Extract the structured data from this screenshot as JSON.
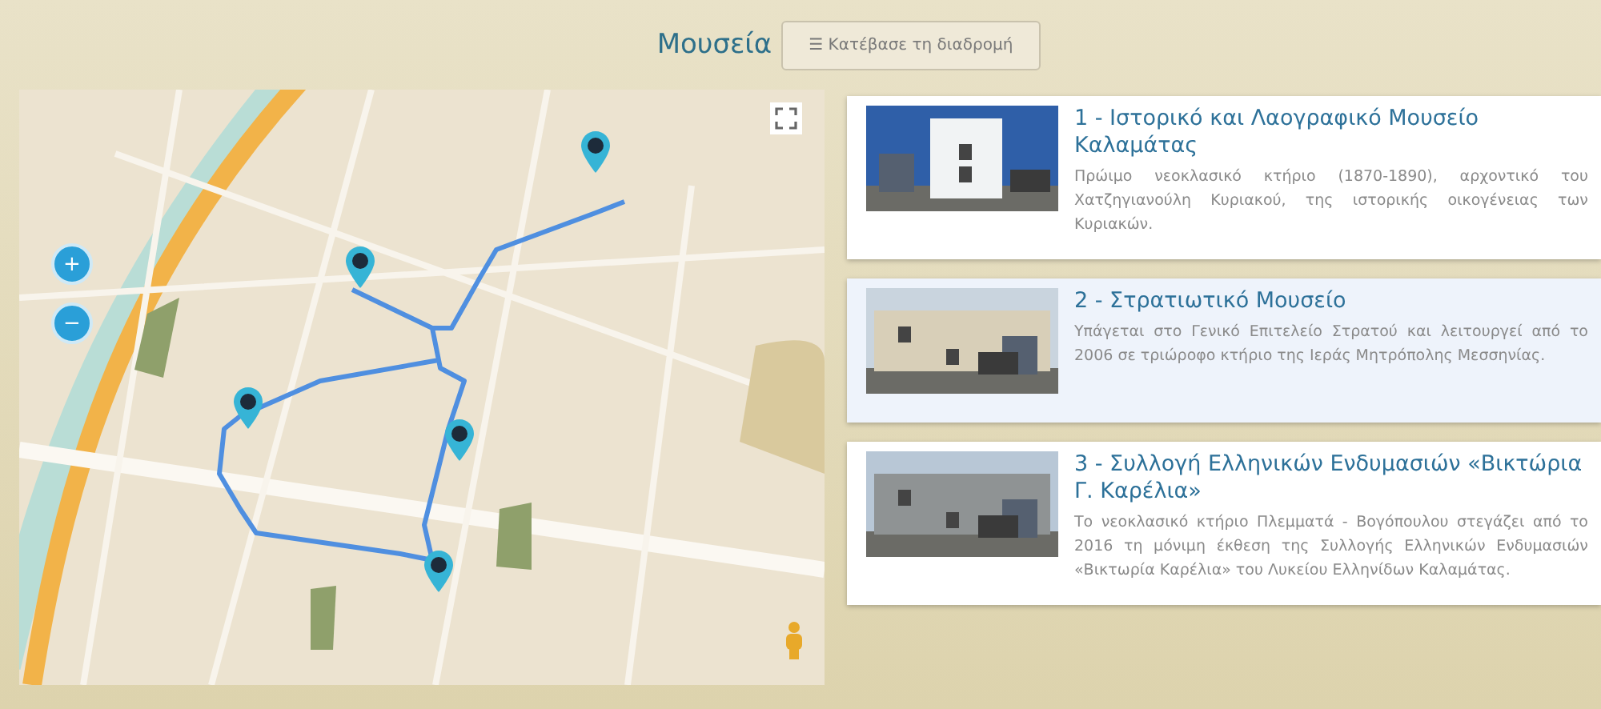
{
  "header": {
    "title": "Μουσεία",
    "download_button": {
      "icon": "☰",
      "label": "Κατέβασε τη διαδρομή"
    }
  },
  "map": {
    "kind": "picture",
    "zoom_in": "+",
    "zoom_out": "−"
  },
  "museums": [
    {
      "title": "1 - Ιστορικό και Λαογραφικό Μουσείο Καλαμάτας",
      "description": "Πρώιμο νεοκλασικό κτήριο (1870-1890), αρχοντικό του Χατζηγιανούλη Κυριακού, της ιστορικής οικογένειας των Κυριακών.",
      "selected": false
    },
    {
      "title": "2 - Στρατιωτικό Μουσείο",
      "description": "Υπάγεται στο Γενικό Επιτελείο Στρατού και λειτουργεί από το 2006 σε τριώροφο κτήριο της Ιεράς Μητρόπολης Μεσσηνίας.",
      "selected": true
    },
    {
      "title": "3 - Συλλογή Ελληνικών Ενδυμασιών «Βικτώρια Γ. Καρέλια»",
      "description": "Το νεοκλασικό κτήριο Πλεμματά - Βογόπουλου στεγάζει από το 2016 τη μόνιμη έκθεση της Συλλογής Ελληνικών Ενδυμασιών «Βικτωρία Καρέλια» του Λυκείου Ελληνίδων Καλαμάτας.",
      "selected": false
    }
  ]
}
